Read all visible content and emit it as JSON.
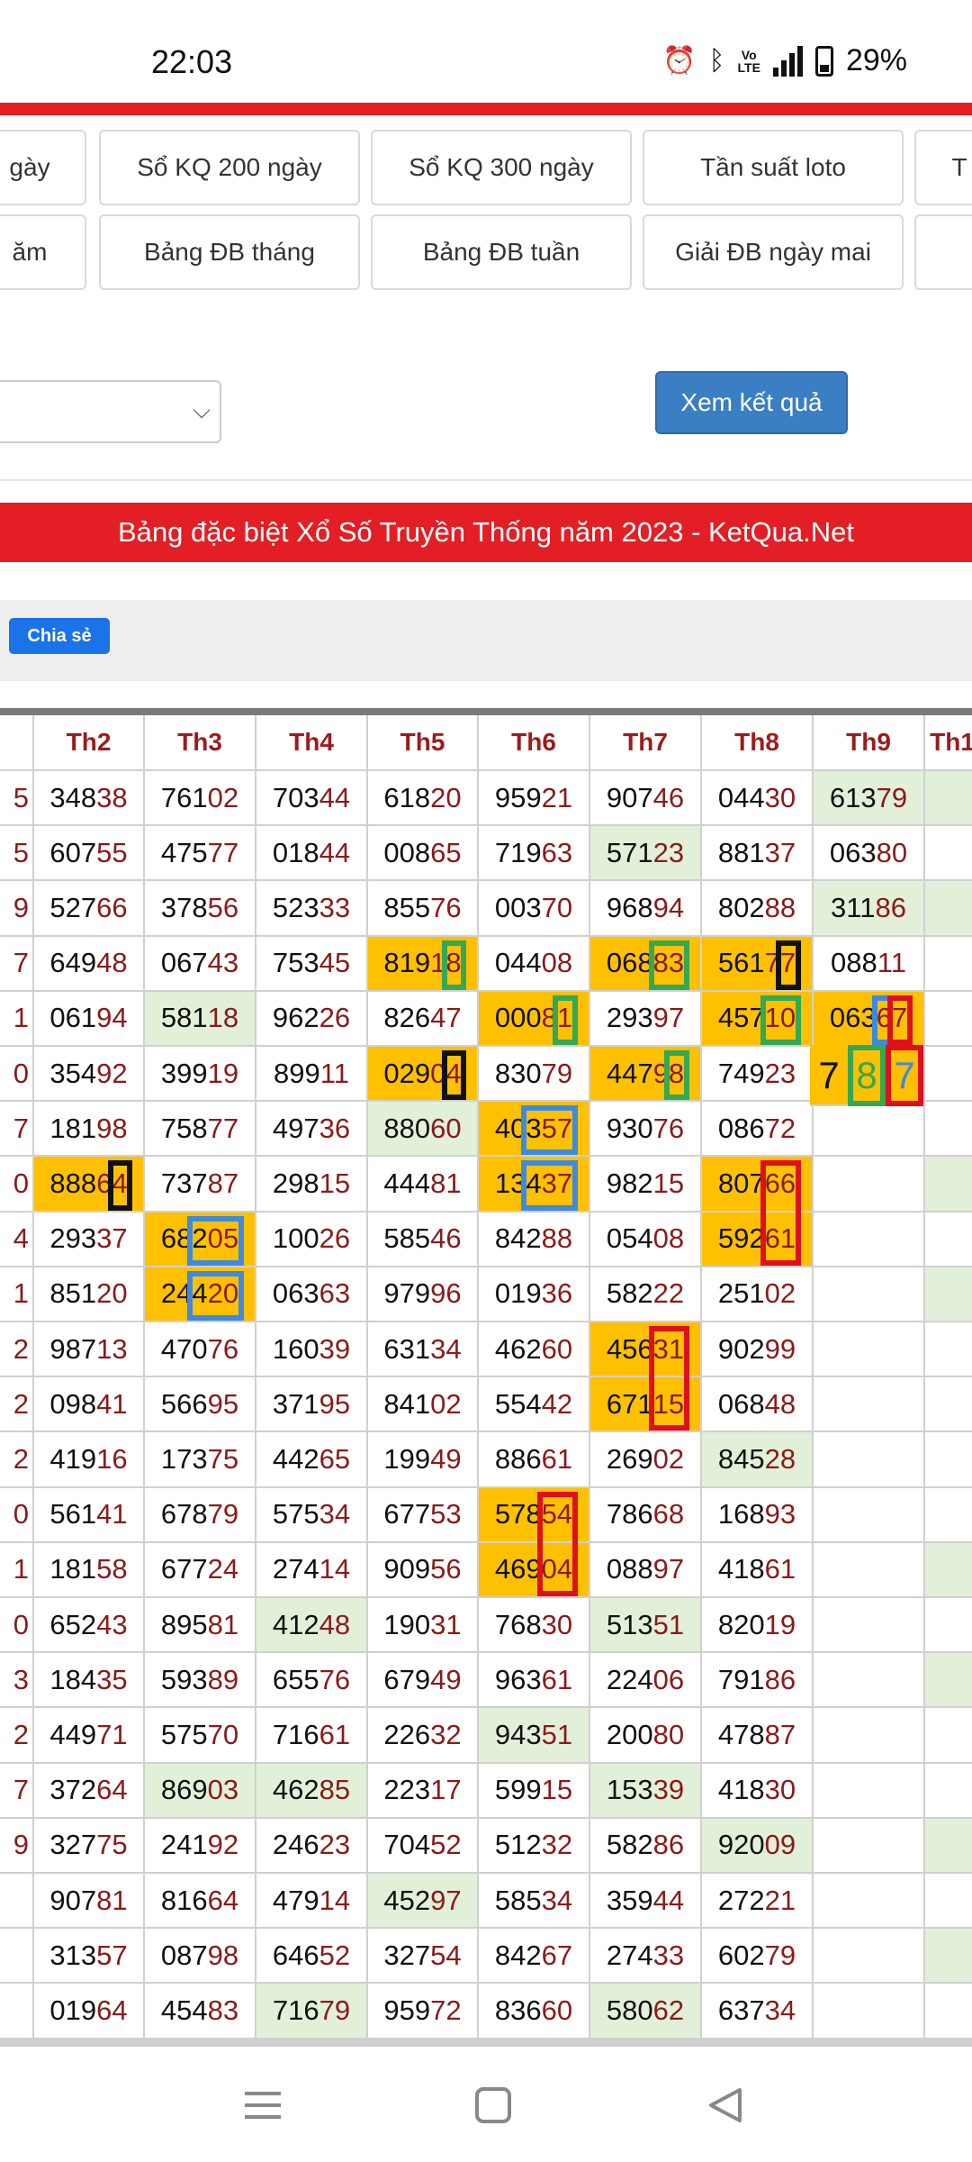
{
  "status_bar": {
    "time": "22:03",
    "battery": "29%"
  },
  "nav_row1": [
    "gày",
    "Sổ KQ 200 ngày",
    "Sổ KQ 300 ngày",
    "Tần suất loto",
    "T"
  ],
  "nav_row2": [
    "ăm",
    "Bảng ĐB tháng",
    "Bảng ĐB tuần",
    "Giải ĐB ngày mai",
    ""
  ],
  "form": {
    "select_value": "",
    "submit_label": "Xem kết quả"
  },
  "title": "Bảng đặc biệt Xổ Số Truyền Thống năm 2023 - KetQua.Net",
  "share_label": "Chia sẻ",
  "table": {
    "headers": [
      "",
      "Th2",
      "Th3",
      "Th4",
      "Th5",
      "Th6",
      "Th7",
      "Th8",
      "Th9",
      "Th1"
    ],
    "left_col": [
      "5",
      "5",
      "9",
      "7",
      "1",
      "0",
      "7",
      "0",
      "4",
      "1",
      "2",
      "2",
      "2",
      "0",
      "1",
      "0",
      "3",
      "2",
      "7",
      "9",
      "",
      "",
      ""
    ],
    "rows": [
      [
        "34838",
        "76102",
        "70344",
        "61820",
        "95921",
        "90746",
        "04430",
        "61379",
        ""
      ],
      [
        "60755",
        "47577",
        "01844",
        "00865",
        "71963",
        "57123",
        "88137",
        "06380",
        ""
      ],
      [
        "52766",
        "37856",
        "52333",
        "85576",
        "00370",
        "96894",
        "80288",
        "31186",
        ""
      ],
      [
        "64948",
        "06743",
        "75345",
        "81918",
        "04408",
        "06883",
        "56177",
        "08811",
        ""
      ],
      [
        "06194",
        "58118",
        "96226",
        "82647",
        "00081",
        "29397",
        "45710",
        "06367",
        ""
      ],
      [
        "35492",
        "39919",
        "89911",
        "02904",
        "83079",
        "44798",
        "74923",
        "",
        ""
      ],
      [
        "18198",
        "75877",
        "49736",
        "88060",
        "40357",
        "93076",
        "08672",
        "",
        ""
      ],
      [
        "88864",
        "73787",
        "29815",
        "44481",
        "13437",
        "98215",
        "80766",
        "",
        ""
      ],
      [
        "29337",
        "68205",
        "10026",
        "58546",
        "84288",
        "05408",
        "59261",
        "",
        ""
      ],
      [
        "85120",
        "24420",
        "06363",
        "97996",
        "01936",
        "58222",
        "25102",
        "",
        ""
      ],
      [
        "98713",
        "47076",
        "16039",
        "63134",
        "46260",
        "45631",
        "90299",
        "",
        ""
      ],
      [
        "09841",
        "56695",
        "37195",
        "84102",
        "55442",
        "67115",
        "06848",
        "",
        ""
      ],
      [
        "41916",
        "17375",
        "44265",
        "19949",
        "88661",
        "26902",
        "84528",
        "",
        ""
      ],
      [
        "56141",
        "67879",
        "57534",
        "67753",
        "57854",
        "78668",
        "16893",
        "",
        ""
      ],
      [
        "18158",
        "67724",
        "27414",
        "90956",
        "46904",
        "08897",
        "41861",
        "",
        ""
      ],
      [
        "65243",
        "89581",
        "41248",
        "19031",
        "76830",
        "51351",
        "82019",
        "",
        ""
      ],
      [
        "18435",
        "59389",
        "65576",
        "67949",
        "96361",
        "22406",
        "79186",
        "",
        ""
      ],
      [
        "44971",
        "57570",
        "71661",
        "22632",
        "94351",
        "20080",
        "47887",
        "",
        ""
      ],
      [
        "37264",
        "86903",
        "46285",
        "22317",
        "59915",
        "15339",
        "41830",
        "",
        ""
      ],
      [
        "32775",
        "24192",
        "24623",
        "70452",
        "51232",
        "58286",
        "92009",
        "",
        ""
      ],
      [
        "90781",
        "81664",
        "47914",
        "45297",
        "58534",
        "35944",
        "27221",
        "",
        ""
      ],
      [
        "31357",
        "08798",
        "64652",
        "32754",
        "84267",
        "27433",
        "60279",
        "",
        ""
      ],
      [
        "01964",
        "45483",
        "71679",
        "95972",
        "83660",
        "58062",
        "63734",
        "",
        ""
      ]
    ],
    "overlay_digits": [
      "7",
      "8",
      "7"
    ]
  },
  "colors": {
    "brand_red": "#e31e24",
    "button_blue": "#3a7fc4",
    "share_blue": "#1a73e8",
    "highlight_orange": "#ffc000",
    "highlight_green": "#e2f0d9",
    "tail_red": "#8b1a1a"
  }
}
